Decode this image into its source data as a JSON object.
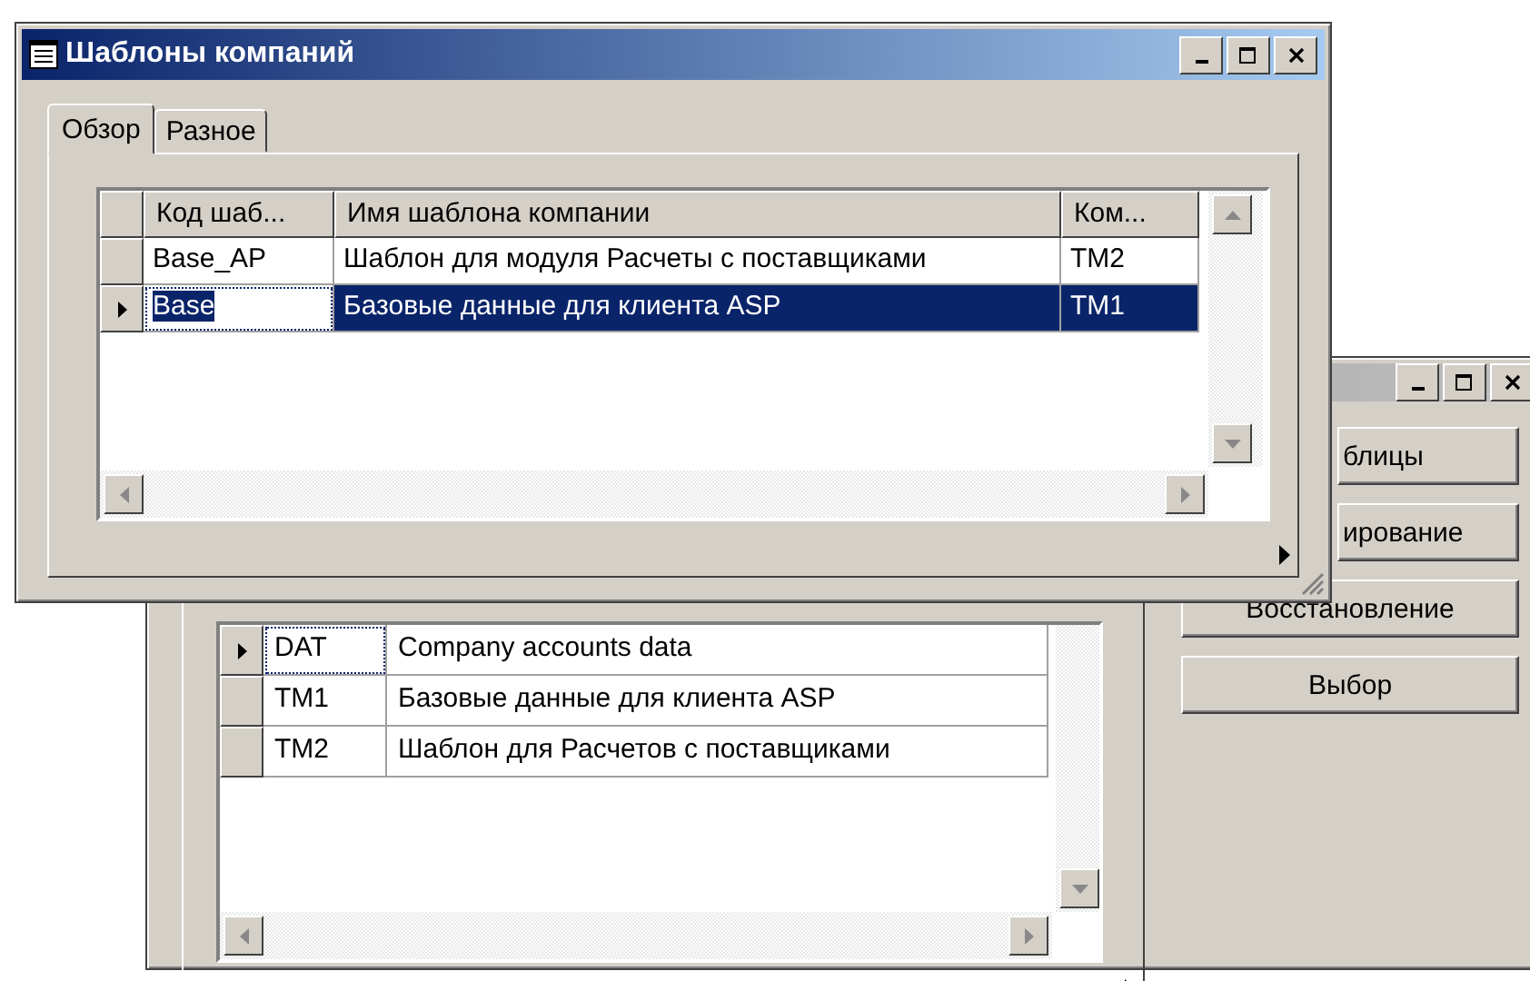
{
  "back_window": {
    "grid": {
      "rows": [
        {
          "code": "DAT",
          "name": "Company accounts data",
          "current": true
        },
        {
          "code": "TM1",
          "name": "Базовые данные для клиента ASP",
          "current": false
        },
        {
          "code": "TM2",
          "name": "Шаблон для Расчетов с поставщиками",
          "current": false
        }
      ]
    },
    "buttons": [
      {
        "label": "блицы",
        "kind": "covered"
      },
      {
        "label": "ирование",
        "kind": "covered"
      },
      {
        "label": "Восстановление",
        "kind": "full"
      },
      {
        "label": "Выбор",
        "kind": "full"
      }
    ]
  },
  "front_window": {
    "title": "Шаблоны компаний",
    "tabs": [
      {
        "label": "Обзор",
        "selected": true
      },
      {
        "label": "Разное",
        "selected": false
      }
    ],
    "grid": {
      "columns": [
        "Код шаб...",
        "Имя шаблона компании",
        "Ком..."
      ],
      "rows": [
        {
          "cells": [
            "Base_AP",
            "Шаблон для модуля Расчеты с поставщиками",
            "TM2"
          ],
          "selected": false
        },
        {
          "cells": [
            "Base",
            "Базовые данные для клиента ASP",
            "TM1"
          ],
          "selected": true
        }
      ]
    }
  }
}
